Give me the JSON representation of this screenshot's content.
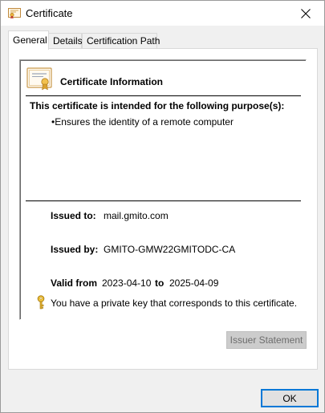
{
  "window": {
    "title": "Certificate",
    "close_glyph": "✕"
  },
  "tabs": [
    {
      "label": "General",
      "active": true
    },
    {
      "label": "Details",
      "active": false
    },
    {
      "label": "Certification Path",
      "active": false
    }
  ],
  "general": {
    "info_title": "Certificate Information",
    "purpose_heading": "This certificate is intended for the following purpose(s):",
    "purposes": [
      "•Ensures the identity of a remote computer"
    ],
    "issued_to_label": "Issued to:",
    "issued_to_value": "mail.gmito.com",
    "issued_by_label": "Issued by:",
    "issued_by_value": "GMITO-GMW22GMITODC-CA",
    "valid_from_label": "Valid from",
    "valid_from_value": "2023-04-10",
    "valid_to_label": "to",
    "valid_to_value": "2025-04-09",
    "private_key_note": "You have a private key that corresponds to this certificate."
  },
  "buttons": {
    "issuer_statement": "Issuer Statement",
    "issuer_statement_enabled": false,
    "ok": "OK"
  },
  "icons": {
    "title": "certificate-icon",
    "close": "close-icon",
    "info": "certificate-icon",
    "key": "key-icon"
  },
  "colors": {
    "ok_border": "#0078d7",
    "disabled_button_bg": "#cccccc",
    "disabled_button_text": "#6d6d6d"
  }
}
